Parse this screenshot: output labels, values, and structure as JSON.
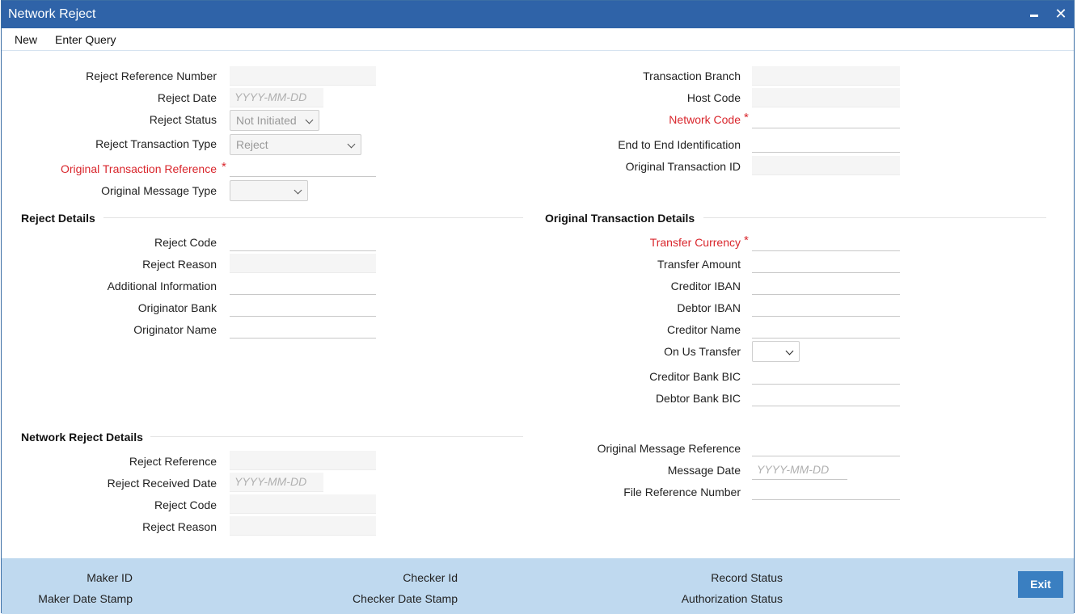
{
  "window": {
    "title": "Network Reject"
  },
  "menu": {
    "new": "New",
    "enter_query": "Enter Query"
  },
  "header_left": {
    "reject_reference_number": "Reject Reference Number",
    "reject_date": "Reject Date",
    "reject_date_placeholder": "YYYY-MM-DD",
    "reject_status": "Reject Status",
    "reject_status_value": "Not Initiated",
    "reject_transaction_type": "Reject Transaction Type",
    "reject_transaction_type_value": "Reject",
    "original_transaction_reference": "Original Transaction Reference",
    "original_message_type": "Original Message Type"
  },
  "header_right": {
    "transaction_branch": "Transaction Branch",
    "host_code": "Host Code",
    "network_code": "Network Code",
    "end_to_end_identification": "End to End Identification",
    "original_transaction_id": "Original Transaction ID"
  },
  "reject_details": {
    "title": "Reject Details",
    "reject_code": "Reject Code",
    "reject_reason": "Reject Reason",
    "additional_information": "Additional Information",
    "originator_bank": "Originator Bank",
    "originator_name": "Originator Name"
  },
  "original_transaction_details": {
    "title": "Original Transaction Details",
    "transfer_currency": "Transfer Currency",
    "transfer_amount": "Transfer Amount",
    "creditor_iban": "Creditor IBAN",
    "debtor_iban": "Debtor IBAN",
    "creditor_name": "Creditor Name",
    "on_us_transfer": "On Us Transfer",
    "creditor_bank_bic": "Creditor Bank BIC",
    "debtor_bank_bic": "Debtor Bank BIC"
  },
  "network_reject_details": {
    "title": "Network Reject Details",
    "reject_reference": "Reject Reference",
    "reject_received_date": "Reject Received Date",
    "reject_received_date_placeholder": "YYYY-MM-DD",
    "reject_code": "Reject Code",
    "reject_reason": "Reject Reason"
  },
  "message_info": {
    "original_message_reference": "Original Message Reference",
    "message_date": "Message Date",
    "message_date_placeholder": "YYYY-MM-DD",
    "file_reference_number": "File Reference Number"
  },
  "footer": {
    "maker_id": "Maker ID",
    "maker_date_stamp": "Maker Date Stamp",
    "checker_id": "Checker Id",
    "checker_date_stamp": "Checker Date Stamp",
    "record_status": "Record Status",
    "authorization_status": "Authorization Status",
    "exit": "Exit"
  },
  "colors": {
    "titlebar": "#2f63a8",
    "footer": "#bfd9ef",
    "required": "#d9262c",
    "exit_button": "#3a7fc1"
  }
}
